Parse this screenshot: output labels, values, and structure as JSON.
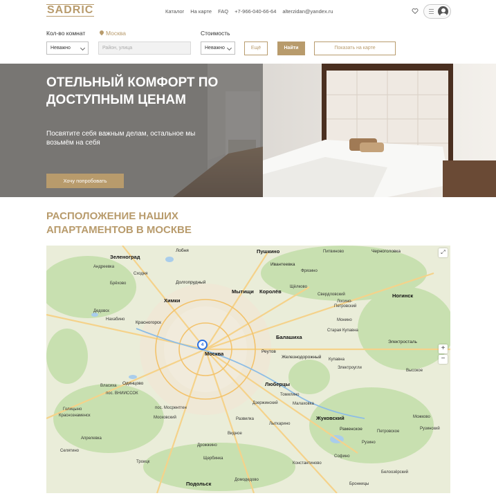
{
  "header": {
    "logo": "SADRIC",
    "nav": [
      "Каталог",
      "На карте",
      "FAQ",
      "+7-966-040-66-64",
      "alterzidan@yandex.ru"
    ]
  },
  "filters": {
    "rooms_label": "Кол-во комнат",
    "rooms_value": "Неважно",
    "city": "Москва",
    "address_placeholder": "Район, улица",
    "price_label": "Стоимость",
    "price_value": "Неважно",
    "more_button": "Ещё",
    "find_button": "Найти",
    "map_button": "Показать на карте"
  },
  "hero": {
    "title": "Отельный комфорт по доступным ценам",
    "subtitle": "Посвятите себя важным делам, остальное мы возьмём на себя",
    "cta": "Хочу попробовать"
  },
  "location": {
    "title": "Расположение наших апартаментов в Москве"
  },
  "map": {
    "cluster_count": "4",
    "zoom_in": "+",
    "zoom_out": "−",
    "labels": {
      "zelenograd": "Зеленоград",
      "lobnya": "Лобня",
      "pushkino": "Пушкино",
      "pitvinovo": "Питвиново",
      "chernogolovka": "Черноголовка",
      "andreevka": "Андреевка",
      "ivanteevka": "Ивантеевка",
      "fryazino": "Фрязино",
      "skhodnya": "Сходня",
      "dolgoprudny": "Долгопрудный",
      "brekhovo": "Брёхово",
      "khimki": "Химки",
      "mytishchi": "Мытищи",
      "korolev": "Королёв",
      "shchelkovo": "Щёлково",
      "sverdlovsky": "Свердловский",
      "losino": "Лосино-",
      "petrovsky": "Петровский",
      "noginsk": "Ногинск",
      "dedovsk": "Дедовск",
      "nakhabino": "Нахабино",
      "krasnogorsk": "Красногорск",
      "monino": "Монино",
      "balashikha": "Балашиха",
      "staraya_kupavna": "Старая Купавна",
      "elektrostal": "Электросталь",
      "moskva": "Москва",
      "reutov": "Реутов",
      "zheleznodorozhny": "Железнодорожный",
      "kupavna": "Купавна",
      "elektrougli": "Электроугли",
      "vlasikha": "Власиха",
      "odintsovo": "Одинцово",
      "vniissok": "пос. ВНИИССОК",
      "lyubertsy": "Люберцы",
      "golitsyno": "Голицыно",
      "tomilino": "Томилино",
      "krasnoznamensk": "Краснознаменск",
      "mosrentgen": "пос. Мосрентген",
      "dzerzhinsky": "Дзержинский",
      "malakhovka": "Малаховка",
      "zhukovsky": "Жуковский",
      "moskovsky": "Московский",
      "razvilka": "Развилка",
      "lytkarino": "Лыткарино",
      "ramenskoe": "Раменское",
      "aprelevka": "Апрелевка",
      "vidnoe": "Видное",
      "selyatino": "Селятино",
      "drozhzhino": "Дрожжино",
      "shcherbinka": "Щербинка",
      "troitsk": "Троицк",
      "podolsk": "Подольск",
      "domodedovo": "Домодедово",
      "belooziorsky": "Белоозёрский",
      "bronnitsy": "Бронницы",
      "ruzino": "Рузино",
      "petrovskoe": "Петровское",
      "sofino": "Софино",
      "konstantinovo": "Константиново",
      "mozhkovo": "Можково",
      "ruzinski": "Рузинский",
      "vysokovo": "Высокое"
    }
  },
  "colors": {
    "accent": "#b89b6c",
    "map_marker": "#2b6fe0"
  }
}
